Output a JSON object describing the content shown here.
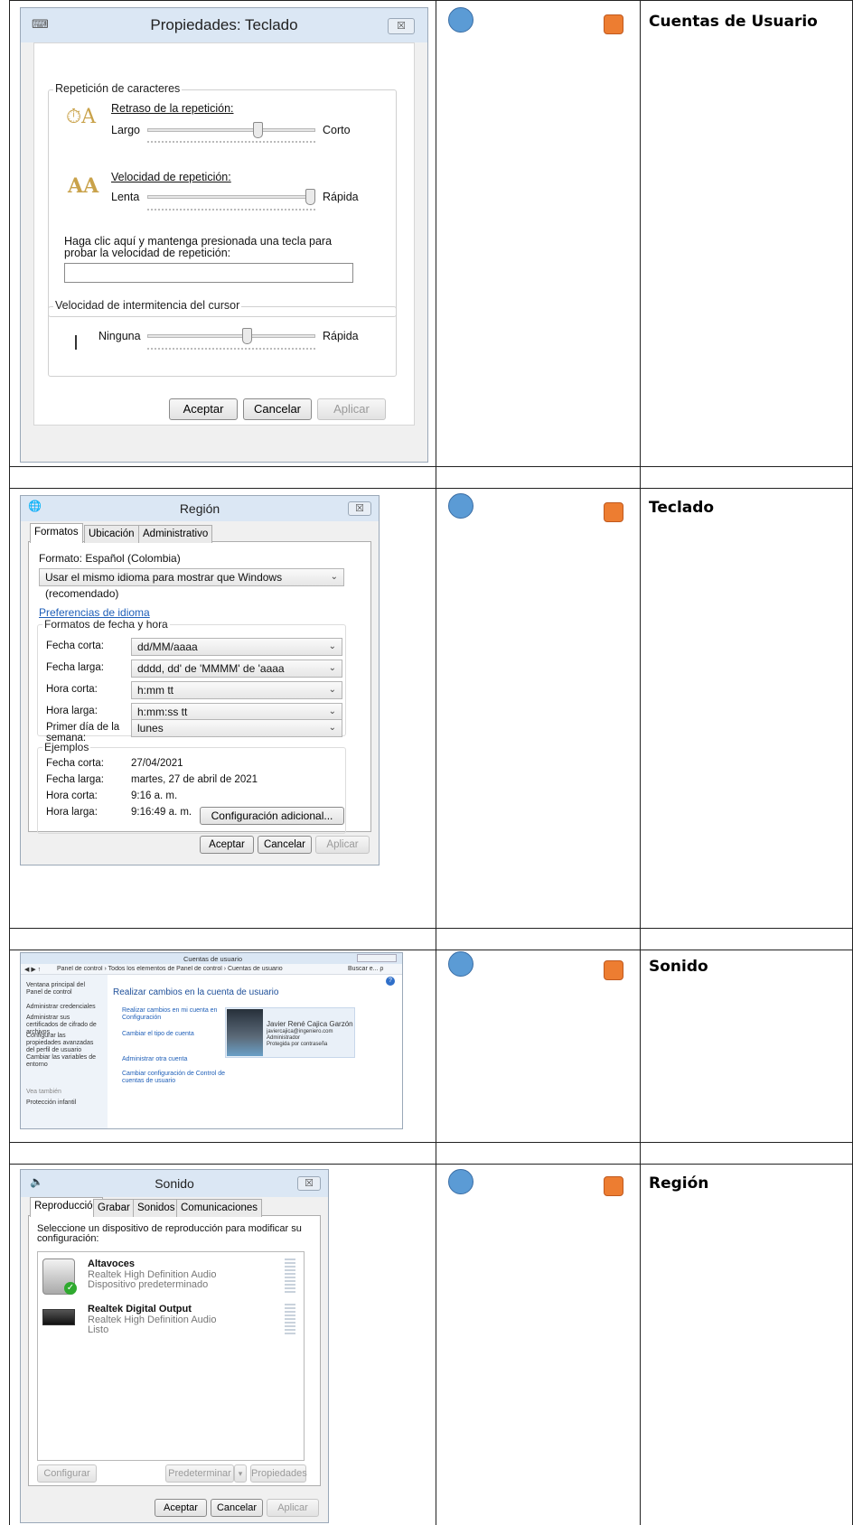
{
  "rows": [
    {
      "label": "Cuentas de Usuario"
    },
    {
      "label": "Teclado"
    },
    {
      "label": "Sonido"
    },
    {
      "label": "Región"
    }
  ],
  "keyboard": {
    "title": "Propiedades: Teclado",
    "close": "☒",
    "group1": "Repetición de caracteres",
    "delay_label": "Retraso de la repetición:",
    "delay_min": "Largo",
    "delay_max": "Corto",
    "delay_level": 0.67,
    "rate_label": "Velocidad de repetición:",
    "rate_min": "Lenta",
    "rate_max": "Rápida",
    "rate_level": 1.0,
    "test_label": "Haga clic aquí y mantenga presionada una tecla para probar la velocidad de repetición:",
    "group2": "Velocidad de intermitencia del cursor",
    "blink_min": "Ninguna",
    "blink_max": "Rápida",
    "blink_level": 0.6,
    "ok": "Aceptar",
    "cancel": "Cancelar",
    "apply": "Aplicar"
  },
  "region": {
    "title": "Región",
    "close": "☒",
    "tabs": [
      "Formatos",
      "Ubicación",
      "Administrativo"
    ],
    "format_label": "Formato: Español (Colombia)",
    "format_value": "Usar el mismo idioma para mostrar que Windows (recomendado)",
    "lang_pref_link": "Preferencias de idioma",
    "dt_group": "Formatos de fecha y hora",
    "fields": [
      {
        "label": "Fecha corta:",
        "value": "dd/MM/aaaa"
      },
      {
        "label": "Fecha larga:",
        "value": "dddd, dd' de 'MMMM' de 'aaaa"
      },
      {
        "label": "Hora corta:",
        "value": "h:mm tt"
      },
      {
        "label": "Hora larga:",
        "value": "h:mm:ss tt"
      },
      {
        "label": "Primer día de la semana:",
        "value": "lunes"
      }
    ],
    "examples_group": "Ejemplos",
    "examples": [
      {
        "label": "Fecha corta:",
        "value": "27/04/2021"
      },
      {
        "label": "Fecha larga:",
        "value": "martes, 27 de abril de 2021"
      },
      {
        "label": "Hora corta:",
        "value": "9:16 a. m."
      },
      {
        "label": "Hora larga:",
        "value": "9:16:49 a. m."
      }
    ],
    "additional": "Configuración adicional...",
    "ok": "Aceptar",
    "cancel": "Cancelar",
    "apply": "Aplicar"
  },
  "accounts": {
    "title": "Cuentas de usuario",
    "address": "Panel de control › Todos los elementos de Panel de control › Cuentas de usuario",
    "search": "Buscar e... ρ",
    "sidebar": [
      "Ventana principal del Panel de control",
      "Administrar credenciales",
      "Administrar sus certificados de cifrado de archivos",
      "Configurar las propiedades avanzadas del perfil de usuario",
      "Cambiar las variables de entorno"
    ],
    "see_also": "Vea también",
    "parental": "Protección infantil",
    "heading": "Realizar cambios en la cuenta de usuario",
    "links": [
      "Realizar cambios en mi cuenta en Configuración",
      "Cambiar el tipo de cuenta",
      "Administrar otra cuenta",
      "Cambiar configuración de Control de cuentas de usuario"
    ],
    "user_name": "Javier René Cajica Garzón",
    "user_email": "javiercajica@ingeniero.com",
    "user_role": "Administrador",
    "user_status": "Protegida por contraseña"
  },
  "sound": {
    "title": "Sonido",
    "close": "☒",
    "tabs": [
      "Reproducción",
      "Grabar",
      "Sonidos",
      "Comunicaciones"
    ],
    "instruction": "Seleccione un dispositivo de reproducción para modificar su configuración:",
    "devices": [
      {
        "name": "Altavoces",
        "driver": "Realtek High Definition Audio",
        "status": "Dispositivo predeterminado"
      },
      {
        "name": "Realtek Digital Output",
        "driver": "Realtek High Definition Audio",
        "status": "Listo"
      }
    ],
    "configure": "Configurar",
    "set_default": "Predeterminar",
    "properties": "Propiedades",
    "ok": "Aceptar",
    "cancel": "Cancelar",
    "apply": "Aplicar"
  }
}
